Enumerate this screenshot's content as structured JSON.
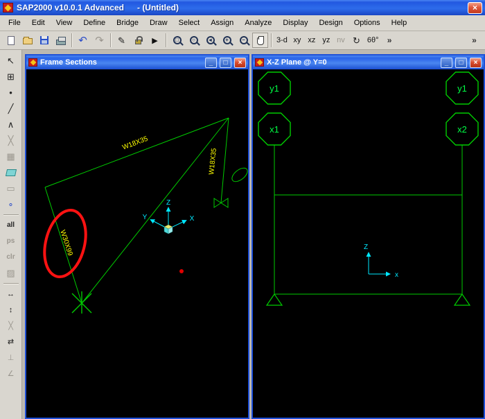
{
  "app": {
    "title": "SAP2000 v10.0.1  Advanced",
    "title_suffix": "- (Untitled)"
  },
  "menu": {
    "items": [
      "File",
      "Edit",
      "View",
      "Define",
      "Bridge",
      "Draw",
      "Select",
      "Assign",
      "Analyze",
      "Display",
      "Design",
      "Options",
      "Help"
    ]
  },
  "toolbar": {
    "view_3d": "3-d",
    "view_xy": "xy",
    "view_xz": "xz",
    "view_yz": "yz",
    "view_nv": "nv",
    "perspective": "6θ°",
    "overflow": "»"
  },
  "left_toolbar": {
    "select_all": "all",
    "previous_selection": "ps",
    "clear_selection": "clr"
  },
  "frame_sections_window": {
    "title": "Frame Sections",
    "labels": {
      "top_member": "W18X35",
      "right_member": "W18X35",
      "left_member": "W30X99"
    },
    "axes": {
      "x": "X",
      "y": "Y",
      "z": "Z"
    }
  },
  "xz_window": {
    "title": "X-Z Plane @ Y=0",
    "grid_labels": {
      "left_top": "y1",
      "left_bottom": "x1",
      "right_top": "y1",
      "right_bottom": "x2"
    },
    "axes": {
      "x": "x",
      "z": "Z"
    }
  },
  "colors": {
    "model_green": "#00cc00",
    "label_yellow": "#ffff00",
    "bright_green": "#00ff44",
    "axis_cyan": "#00e8ff",
    "highlight_red": "#ff1212",
    "titlebar_blue": "#2a63e8",
    "canvas_black": "#000000"
  }
}
